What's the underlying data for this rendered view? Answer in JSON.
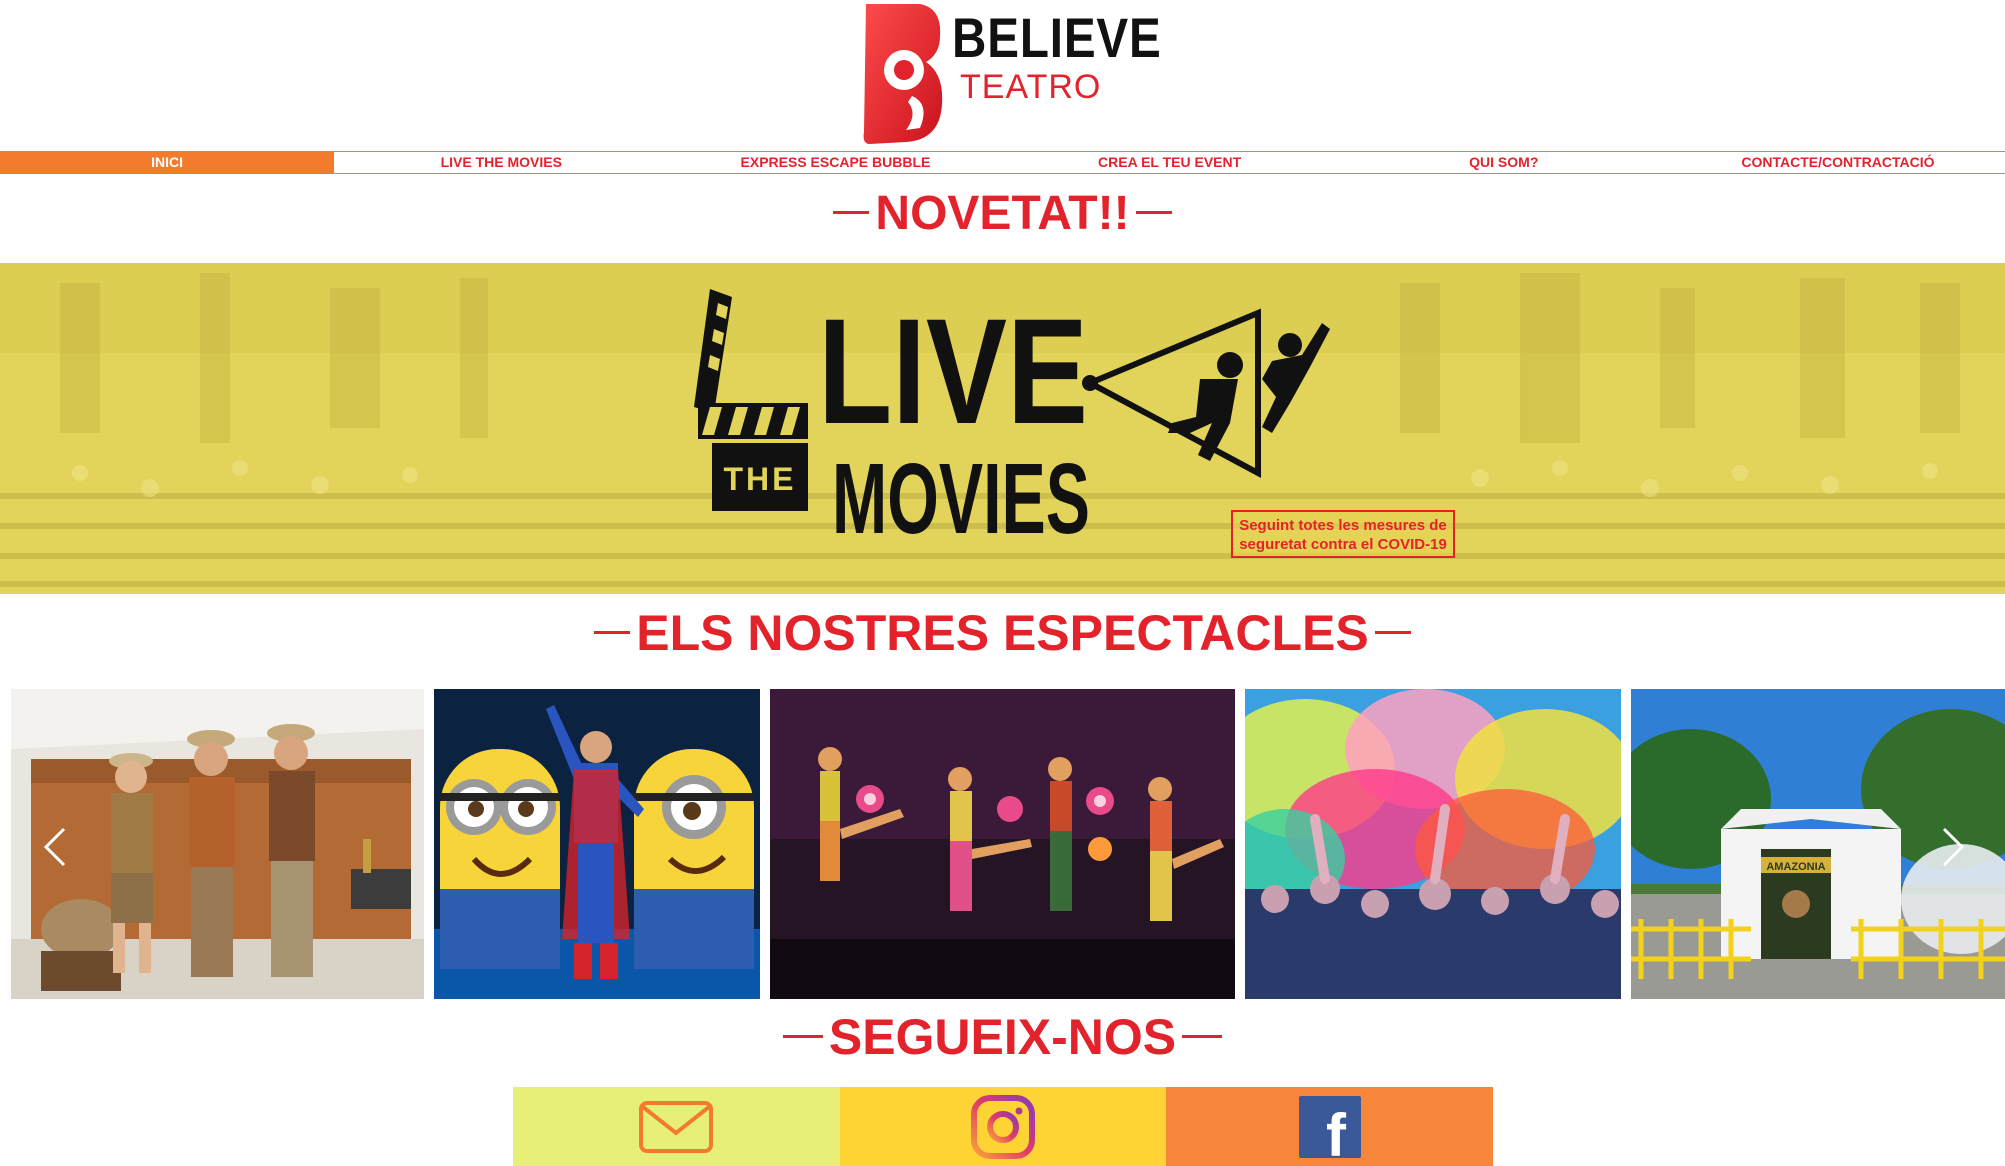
{
  "brand": {
    "name": "BELIEVE",
    "subtitle": "TEATRO",
    "red": "#e3232c",
    "orange": "#f27b2e"
  },
  "nav": {
    "items": [
      {
        "label": "INICI",
        "active": true
      },
      {
        "label": "LIVE THE MOVIES",
        "active": false
      },
      {
        "label": "EXPRESS ESCAPE BUBBLE",
        "active": false
      },
      {
        "label": "CREA EL TEU EVENT",
        "active": false
      },
      {
        "label": "QUI SOM?",
        "active": false
      },
      {
        "label": "CONTACTE/CONTRACTACIÓ",
        "active": false
      }
    ]
  },
  "sections": {
    "novetat": "NOVETAT!!",
    "espectacles": "ELS NOSTRES ESPECTACLES",
    "segueix": "SEGUEIX-NOS"
  },
  "banner": {
    "logo_line1": "LIVE",
    "logo_the": "THE",
    "logo_line2": "MOVIES",
    "covid_line1": "Seguint totes les mesures de",
    "covid_line2": "seguretat contra el COVID-19"
  },
  "gallery": {
    "prev_icon": "chevron-left-icon",
    "next_icon": "chevron-right-icon",
    "slides": [
      "explorers-show",
      "minions-show",
      "dance-show",
      "holi-color-party",
      "escape-bubble-tent"
    ],
    "tent_sign": "AMAZONIA"
  },
  "social": {
    "items": [
      {
        "icon": "mail-icon",
        "bg": "#e8ef78"
      },
      {
        "icon": "instagram-icon",
        "bg": "#fdd434"
      },
      {
        "icon": "facebook-icon",
        "bg": "#f7863a"
      }
    ],
    "facebook_glyph": "f"
  }
}
